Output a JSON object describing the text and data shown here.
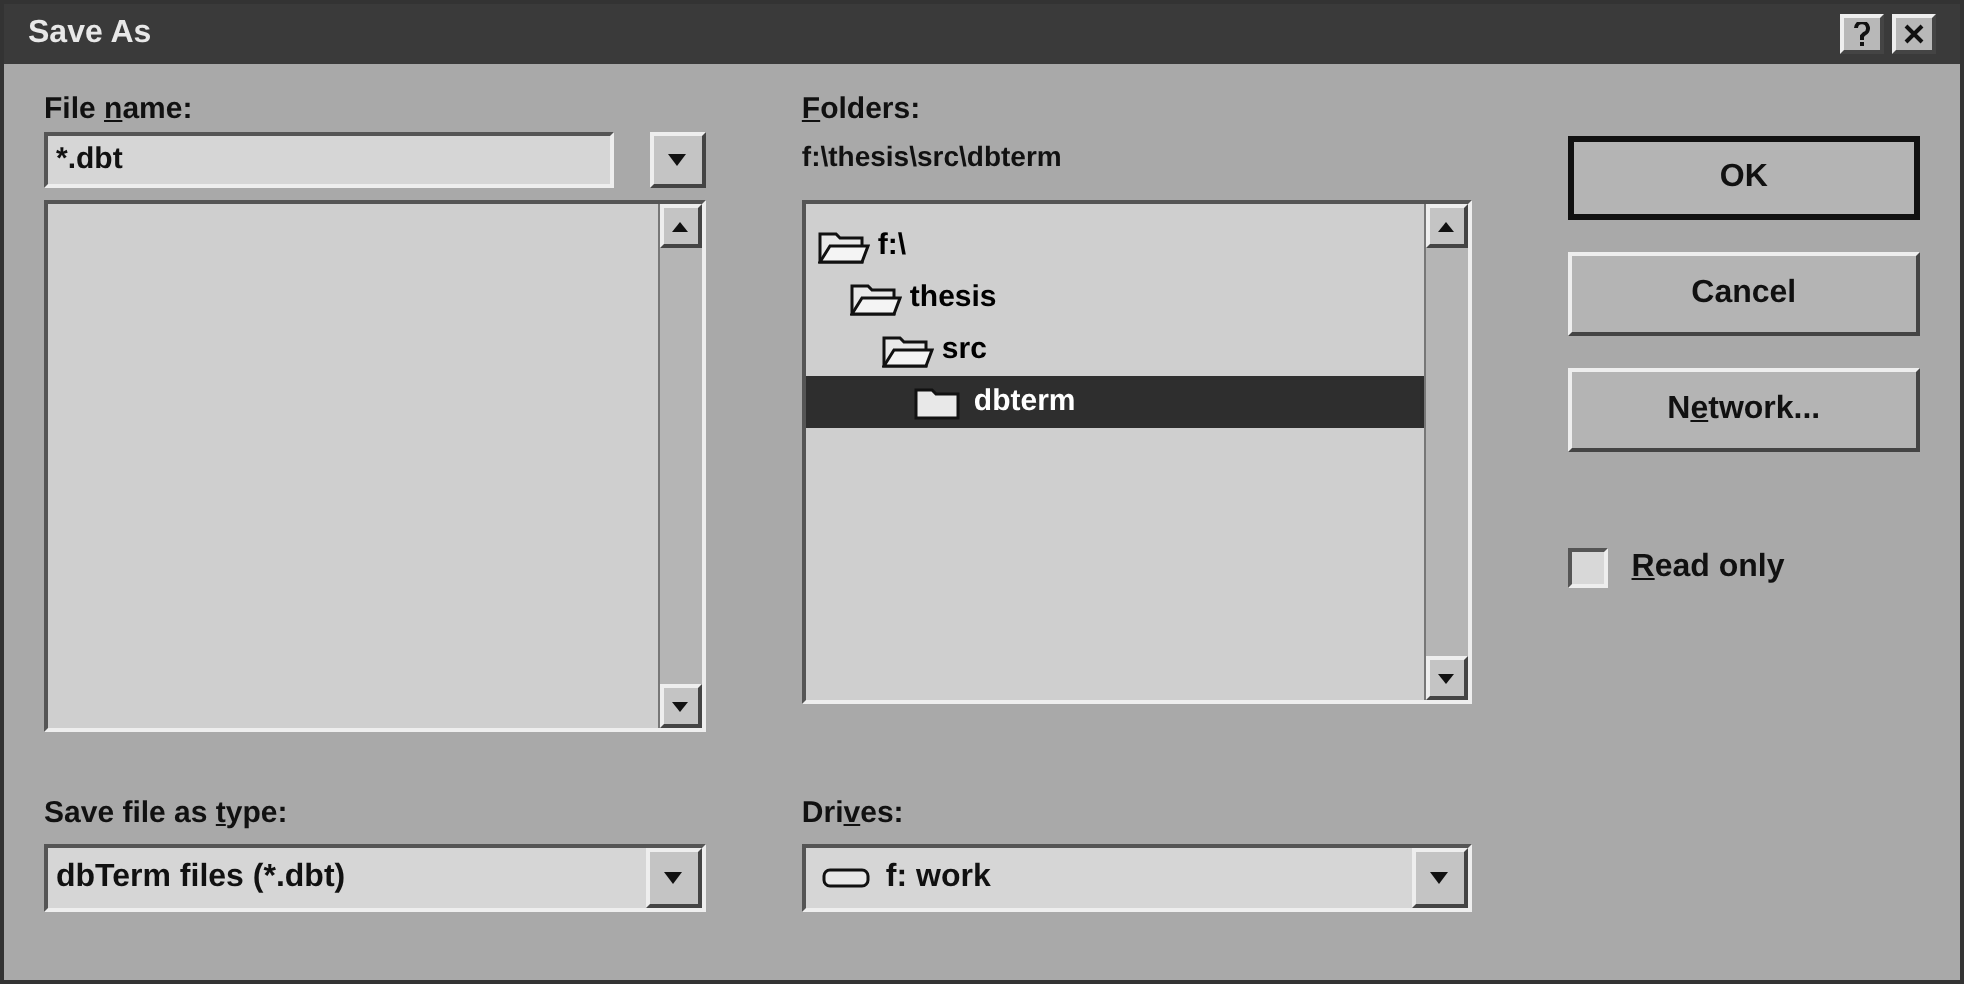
{
  "window": {
    "title": "Save As"
  },
  "file_name": {
    "label": {
      "before": "File ",
      "key": "n",
      "after": "ame:"
    },
    "value": "*.dbt"
  },
  "save_as_type": {
    "label": {
      "before": "Save file as ",
      "key": "t",
      "after": "ype:"
    },
    "value": "dbTerm files (*.dbt)"
  },
  "folders": {
    "label": {
      "key": "F",
      "after": "olders:"
    },
    "path": "f:\\thesis\\src\\dbterm",
    "tree": [
      {
        "name": "f:\\",
        "selected": false,
        "children": [
          {
            "name": "thesis",
            "selected": false,
            "children": [
              {
                "name": "src",
                "selected": false,
                "children": [
                  {
                    "name": "dbterm",
                    "selected": true
                  }
                ]
              }
            ]
          }
        ]
      }
    ]
  },
  "drives": {
    "label": {
      "before": "Dri",
      "key": "v",
      "after": "es:"
    },
    "value": "f: work"
  },
  "buttons": [
    {
      "label": {
        "before": "OK"
      },
      "default": true
    },
    {
      "label": {
        "before": "Cancel"
      },
      "default": false
    },
    {
      "label": {
        "before": "N",
        "key": "e",
        "after": "twork..."
      },
      "default": false
    }
  ],
  "read_only": {
    "label": {
      "key": "R",
      "after": "ead only"
    },
    "checked": false
  }
}
